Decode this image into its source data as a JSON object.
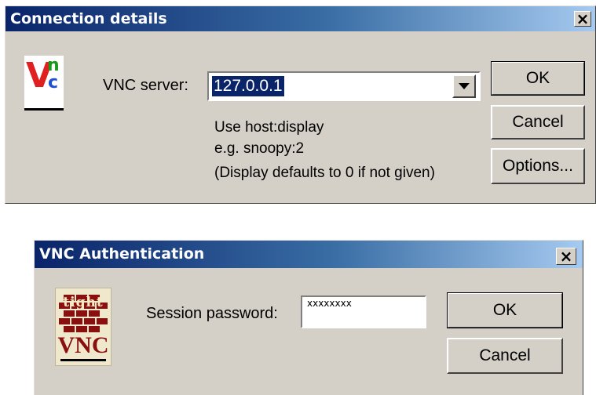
{
  "connection_dialog": {
    "title": "Connection details",
    "server_label": "VNC server:",
    "server_value": "127.0.0.1",
    "help_lines": [
      "Use host:display",
      "e.g. snoopy:2",
      "(Display defaults to 0 if not given)"
    ],
    "ok_label": "OK",
    "cancel_label": "Cancel",
    "options_label": "Options...",
    "close_glyph": "×",
    "logo_letters": [
      "V",
      "n",
      "c"
    ]
  },
  "auth_dialog": {
    "title": "VNC Authentication",
    "password_label": "Session password:",
    "password_value": "xxxxxxxx",
    "ok_label": "OK",
    "cancel_label": "Cancel",
    "close_glyph": "×",
    "logo_top": "tight",
    "logo_bottom": "VNC"
  },
  "colors": {
    "titlebar_start": "#0a246a",
    "titlebar_end": "#a6caf0",
    "dialog_face": "#d4d0c8",
    "selection": "#0a246a"
  }
}
